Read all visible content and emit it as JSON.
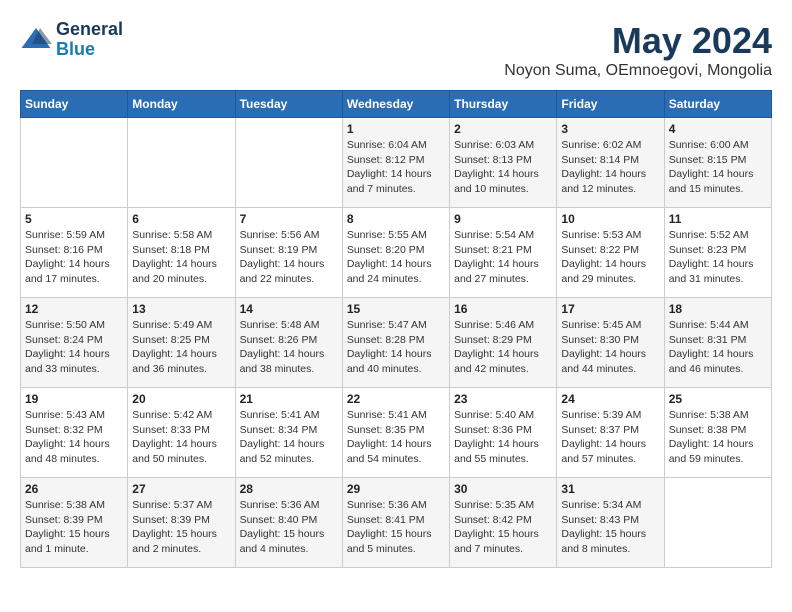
{
  "header": {
    "logo_line1": "General",
    "logo_line2": "Blue",
    "month_title": "May 2024",
    "subtitle": "Noyon Suma, OEmnoegovi, Mongolia"
  },
  "weekdays": [
    "Sunday",
    "Monday",
    "Tuesday",
    "Wednesday",
    "Thursday",
    "Friday",
    "Saturday"
  ],
  "weeks": [
    [
      {
        "day": "",
        "sunrise": "",
        "sunset": "",
        "daylight": ""
      },
      {
        "day": "",
        "sunrise": "",
        "sunset": "",
        "daylight": ""
      },
      {
        "day": "",
        "sunrise": "",
        "sunset": "",
        "daylight": ""
      },
      {
        "day": "1",
        "sunrise": "Sunrise: 6:04 AM",
        "sunset": "Sunset: 8:12 PM",
        "daylight": "Daylight: 14 hours and 7 minutes."
      },
      {
        "day": "2",
        "sunrise": "Sunrise: 6:03 AM",
        "sunset": "Sunset: 8:13 PM",
        "daylight": "Daylight: 14 hours and 10 minutes."
      },
      {
        "day": "3",
        "sunrise": "Sunrise: 6:02 AM",
        "sunset": "Sunset: 8:14 PM",
        "daylight": "Daylight: 14 hours and 12 minutes."
      },
      {
        "day": "4",
        "sunrise": "Sunrise: 6:00 AM",
        "sunset": "Sunset: 8:15 PM",
        "daylight": "Daylight: 14 hours and 15 minutes."
      }
    ],
    [
      {
        "day": "5",
        "sunrise": "Sunrise: 5:59 AM",
        "sunset": "Sunset: 8:16 PM",
        "daylight": "Daylight: 14 hours and 17 minutes."
      },
      {
        "day": "6",
        "sunrise": "Sunrise: 5:58 AM",
        "sunset": "Sunset: 8:18 PM",
        "daylight": "Daylight: 14 hours and 20 minutes."
      },
      {
        "day": "7",
        "sunrise": "Sunrise: 5:56 AM",
        "sunset": "Sunset: 8:19 PM",
        "daylight": "Daylight: 14 hours and 22 minutes."
      },
      {
        "day": "8",
        "sunrise": "Sunrise: 5:55 AM",
        "sunset": "Sunset: 8:20 PM",
        "daylight": "Daylight: 14 hours and 24 minutes."
      },
      {
        "day": "9",
        "sunrise": "Sunrise: 5:54 AM",
        "sunset": "Sunset: 8:21 PM",
        "daylight": "Daylight: 14 hours and 27 minutes."
      },
      {
        "day": "10",
        "sunrise": "Sunrise: 5:53 AM",
        "sunset": "Sunset: 8:22 PM",
        "daylight": "Daylight: 14 hours and 29 minutes."
      },
      {
        "day": "11",
        "sunrise": "Sunrise: 5:52 AM",
        "sunset": "Sunset: 8:23 PM",
        "daylight": "Daylight: 14 hours and 31 minutes."
      }
    ],
    [
      {
        "day": "12",
        "sunrise": "Sunrise: 5:50 AM",
        "sunset": "Sunset: 8:24 PM",
        "daylight": "Daylight: 14 hours and 33 minutes."
      },
      {
        "day": "13",
        "sunrise": "Sunrise: 5:49 AM",
        "sunset": "Sunset: 8:25 PM",
        "daylight": "Daylight: 14 hours and 36 minutes."
      },
      {
        "day": "14",
        "sunrise": "Sunrise: 5:48 AM",
        "sunset": "Sunset: 8:26 PM",
        "daylight": "Daylight: 14 hours and 38 minutes."
      },
      {
        "day": "15",
        "sunrise": "Sunrise: 5:47 AM",
        "sunset": "Sunset: 8:28 PM",
        "daylight": "Daylight: 14 hours and 40 minutes."
      },
      {
        "day": "16",
        "sunrise": "Sunrise: 5:46 AM",
        "sunset": "Sunset: 8:29 PM",
        "daylight": "Daylight: 14 hours and 42 minutes."
      },
      {
        "day": "17",
        "sunrise": "Sunrise: 5:45 AM",
        "sunset": "Sunset: 8:30 PM",
        "daylight": "Daylight: 14 hours and 44 minutes."
      },
      {
        "day": "18",
        "sunrise": "Sunrise: 5:44 AM",
        "sunset": "Sunset: 8:31 PM",
        "daylight": "Daylight: 14 hours and 46 minutes."
      }
    ],
    [
      {
        "day": "19",
        "sunrise": "Sunrise: 5:43 AM",
        "sunset": "Sunset: 8:32 PM",
        "daylight": "Daylight: 14 hours and 48 minutes."
      },
      {
        "day": "20",
        "sunrise": "Sunrise: 5:42 AM",
        "sunset": "Sunset: 8:33 PM",
        "daylight": "Daylight: 14 hours and 50 minutes."
      },
      {
        "day": "21",
        "sunrise": "Sunrise: 5:41 AM",
        "sunset": "Sunset: 8:34 PM",
        "daylight": "Daylight: 14 hours and 52 minutes."
      },
      {
        "day": "22",
        "sunrise": "Sunrise: 5:41 AM",
        "sunset": "Sunset: 8:35 PM",
        "daylight": "Daylight: 14 hours and 54 minutes."
      },
      {
        "day": "23",
        "sunrise": "Sunrise: 5:40 AM",
        "sunset": "Sunset: 8:36 PM",
        "daylight": "Daylight: 14 hours and 55 minutes."
      },
      {
        "day": "24",
        "sunrise": "Sunrise: 5:39 AM",
        "sunset": "Sunset: 8:37 PM",
        "daylight": "Daylight: 14 hours and 57 minutes."
      },
      {
        "day": "25",
        "sunrise": "Sunrise: 5:38 AM",
        "sunset": "Sunset: 8:38 PM",
        "daylight": "Daylight: 14 hours and 59 minutes."
      }
    ],
    [
      {
        "day": "26",
        "sunrise": "Sunrise: 5:38 AM",
        "sunset": "Sunset: 8:39 PM",
        "daylight": "Daylight: 15 hours and 1 minute."
      },
      {
        "day": "27",
        "sunrise": "Sunrise: 5:37 AM",
        "sunset": "Sunset: 8:39 PM",
        "daylight": "Daylight: 15 hours and 2 minutes."
      },
      {
        "day": "28",
        "sunrise": "Sunrise: 5:36 AM",
        "sunset": "Sunset: 8:40 PM",
        "daylight": "Daylight: 15 hours and 4 minutes."
      },
      {
        "day": "29",
        "sunrise": "Sunrise: 5:36 AM",
        "sunset": "Sunset: 8:41 PM",
        "daylight": "Daylight: 15 hours and 5 minutes."
      },
      {
        "day": "30",
        "sunrise": "Sunrise: 5:35 AM",
        "sunset": "Sunset: 8:42 PM",
        "daylight": "Daylight: 15 hours and 7 minutes."
      },
      {
        "day": "31",
        "sunrise": "Sunrise: 5:34 AM",
        "sunset": "Sunset: 8:43 PM",
        "daylight": "Daylight: 15 hours and 8 minutes."
      },
      {
        "day": "",
        "sunrise": "",
        "sunset": "",
        "daylight": ""
      }
    ]
  ]
}
